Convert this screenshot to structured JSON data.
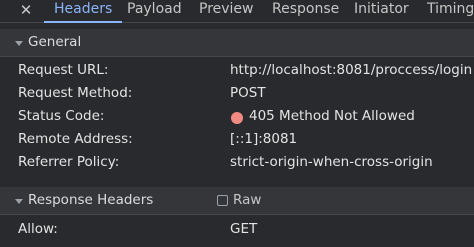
{
  "tabs": [
    {
      "label": "Headers",
      "active": true
    },
    {
      "label": "Payload"
    },
    {
      "label": "Preview"
    },
    {
      "label": "Response"
    },
    {
      "label": "Initiator"
    },
    {
      "label": "Timing"
    }
  ],
  "general": {
    "title": "General",
    "rows": [
      {
        "key": "Request URL:",
        "value": "http://localhost:8081/proccess/login"
      },
      {
        "key": "Request Method:",
        "value": "POST"
      },
      {
        "key": "Status Code:",
        "value": "405 Method Not Allowed",
        "status_color": "#f28b82"
      },
      {
        "key": "Remote Address:",
        "value": "[::1]:8081"
      },
      {
        "key": "Referrer Policy:",
        "value": "strict-origin-when-cross-origin"
      }
    ]
  },
  "response_headers": {
    "title": "Response Headers",
    "raw_label": "Raw",
    "raw_checked": false,
    "rows": [
      {
        "key": "Allow:",
        "value": "GET"
      }
    ]
  },
  "colors": {
    "background": "#292a2d",
    "section_header": "#35363a",
    "accent": "#8ab4f8",
    "error": "#f28b82"
  }
}
